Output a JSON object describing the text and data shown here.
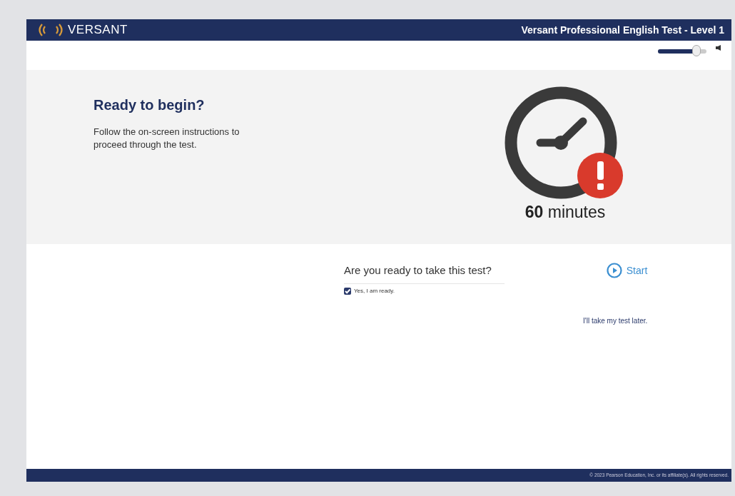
{
  "header": {
    "logo": "VERSANT",
    "title": "Versant Professional English Test - Level 1"
  },
  "volume": {
    "level": 0.8
  },
  "intro": {
    "heading": "Ready to begin?",
    "text": "Follow the on-screen instructions to proceed through the test.",
    "duration": "**60** minutes"
  },
  "question": {
    "text": "Are you ready to take this test?",
    "checkbox": {
      "label": "Yes, I am ready.",
      "checked": true
    },
    "start": "Start",
    "later": "I'll take my test later."
  },
  "footer": "© 2023 Pearson Education, Inc. or its affiliate(s). All rights reserved."
}
